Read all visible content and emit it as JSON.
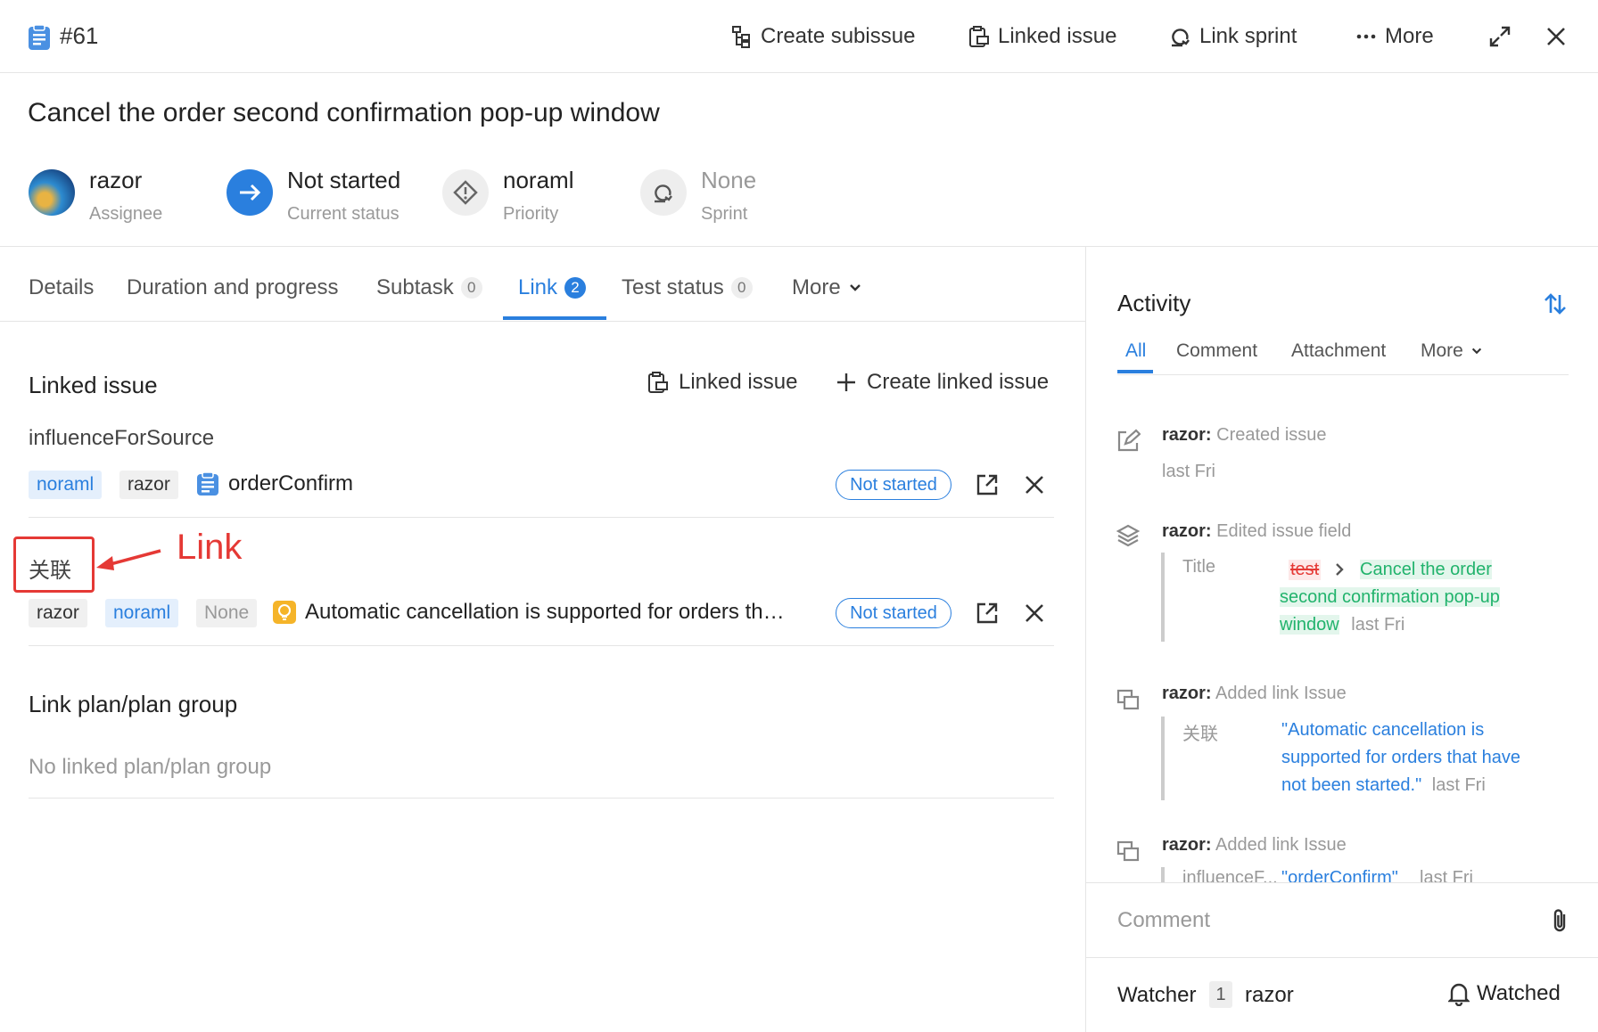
{
  "header": {
    "issue_id": "#61",
    "actions": [
      "Create subissue",
      "Linked issue",
      "Link sprint",
      "More"
    ]
  },
  "issue": {
    "title": "Cancel the order second confirmation pop-up window",
    "fields": [
      {
        "value": "razor",
        "label": "Assignee"
      },
      {
        "value": "Not started",
        "label": "Current status"
      },
      {
        "value": "noraml",
        "label": "Priority"
      },
      {
        "value": "None",
        "label": "Sprint"
      }
    ]
  },
  "tabs": [
    {
      "label": "Details"
    },
    {
      "label": "Duration and progress"
    },
    {
      "label": "Subtask",
      "count": "0"
    },
    {
      "label": "Link",
      "count": "2"
    },
    {
      "label": "Test status",
      "count": "0"
    },
    {
      "label": "More"
    }
  ],
  "linked_section": {
    "title": "Linked issue",
    "linked_issue_action": "Linked issue",
    "create_action": "Create linked issue",
    "groups": [
      {
        "relation": "influenceForSource",
        "tags": [
          "noraml",
          "razor"
        ],
        "title": "orderConfirm",
        "status": "Not started"
      },
      {
        "relation": "关联",
        "tags": [
          "razor",
          "noraml",
          "None"
        ],
        "title": "Automatic cancellation is supported for orders th…",
        "status": "Not started"
      }
    ]
  },
  "plan_section": {
    "title": "Link plan/plan group",
    "empty": "No linked plan/plan group"
  },
  "annotation": {
    "label": "Link",
    "color": "#e53935"
  },
  "activity": {
    "title": "Activity",
    "tabs": [
      "All",
      "Comment",
      "Attachment",
      "More"
    ],
    "events": [
      {
        "user": "razor:",
        "action": "Created issue",
        "time": "last Fri"
      },
      {
        "user": "razor:",
        "action": "Edited issue field",
        "field": "Title",
        "old": "test",
        "new": "Cancel the order second confirmation pop-up window",
        "time": "last Fri"
      },
      {
        "user": "razor:",
        "action": "Added link Issue",
        "relation": "关联",
        "link": "\"Automatic cancellation is supported for orders that have not been started.\"",
        "time": "last Fri"
      },
      {
        "user": "razor:",
        "action": "Added link Issue",
        "relation": "influenceF...",
        "link": "\"orderConfirm\"",
        "time": "last Fri"
      }
    ]
  },
  "comment": {
    "placeholder": "Comment"
  },
  "watcher": {
    "label": "Watcher",
    "count": "1",
    "name": "razor",
    "status": "Watched"
  },
  "colors": {
    "accent": "#2a7fde",
    "annotation": "#e53935",
    "added": "#21b36c",
    "removed": "#e53935"
  }
}
